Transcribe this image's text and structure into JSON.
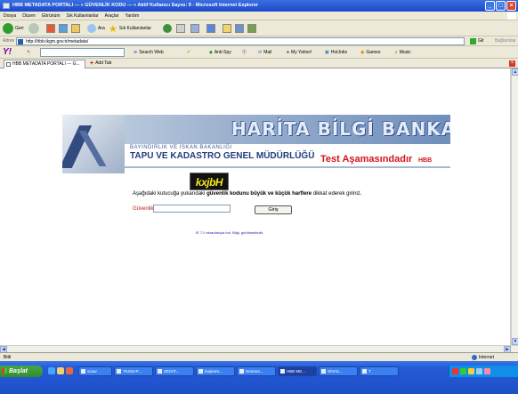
{
  "window": {
    "title": "HBB METADATA PORTALI --- « GÜVENLİK KODU --- » Aktif Kullanıcı Sayısı: 9 - Microsoft Internet Explorer",
    "buttons": [
      "_",
      "□",
      "×"
    ]
  },
  "menu": [
    "Dosya",
    "Düzen",
    "Görünüm",
    "Sık Kullanılanlar",
    "Araçlar",
    "Yardım"
  ],
  "toolbar": {
    "back_label": "Geri",
    "search_label": "Ara",
    "favorites_label": "Sık Kullanılanlar"
  },
  "address": {
    "label": "Adres",
    "value": "http://hbb.tkgm.gov.tr/metadata/",
    "go_label": "Git",
    "links_label": "Bağlantılar"
  },
  "yahoo": {
    "logo": "Y!",
    "search_web": "Search Web",
    "antispy": "Anti-Spy",
    "mail": "Mail",
    "myyahoo": "My Yahoo!",
    "hotjobs": "HotJobs",
    "games": "Games",
    "music": "Music"
  },
  "tabs": {
    "active": "HBB METADATA PORTALI --- G...",
    "add_tab": "Add Tab"
  },
  "banner": {
    "title": "HARİTA BİLGİ BANKASI",
    "org_sub": "BAYINDIRLIK VE İSKAN BAKANLIĞI",
    "org_name": "TAPU VE KADASTRO GENEL MÜDÜRLÜĞÜ",
    "test_status": "Test Aşamasındadır",
    "hbb": "HBB"
  },
  "form": {
    "captcha": "kxjbH",
    "instruction_1": "Aşağıdaki kutucuğa yukarıdaki ",
    "instruction_bold": "güvenlik kodunu büyük ve  küçük harflere",
    "instruction_2": " dikkat ederek giriniz.",
    "security_label": "Güvenlik Kodu",
    "security_value": "",
    "submit_label": "Giriş",
    "note": "IE 7.0 ekranlarıyla İnd. Bilgi. görülmektedir."
  },
  "status": {
    "left": "Bitti",
    "zone": "Internet"
  },
  "taskbar": {
    "start": "Başlat",
    "tasks": [
      "sınav",
      "TKGM-P...",
      "3EDAT...",
      "başkent...",
      "Netoma...",
      "HBB ME...",
      "SİVAS...",
      "T"
    ]
  },
  "colors": {
    "title_blue": "#1d48c9",
    "banner_title": "#e6ecf7",
    "org_blue": "#1e3d7e",
    "warning_red": "#d4151d",
    "start_green": "#2f8e2c"
  }
}
